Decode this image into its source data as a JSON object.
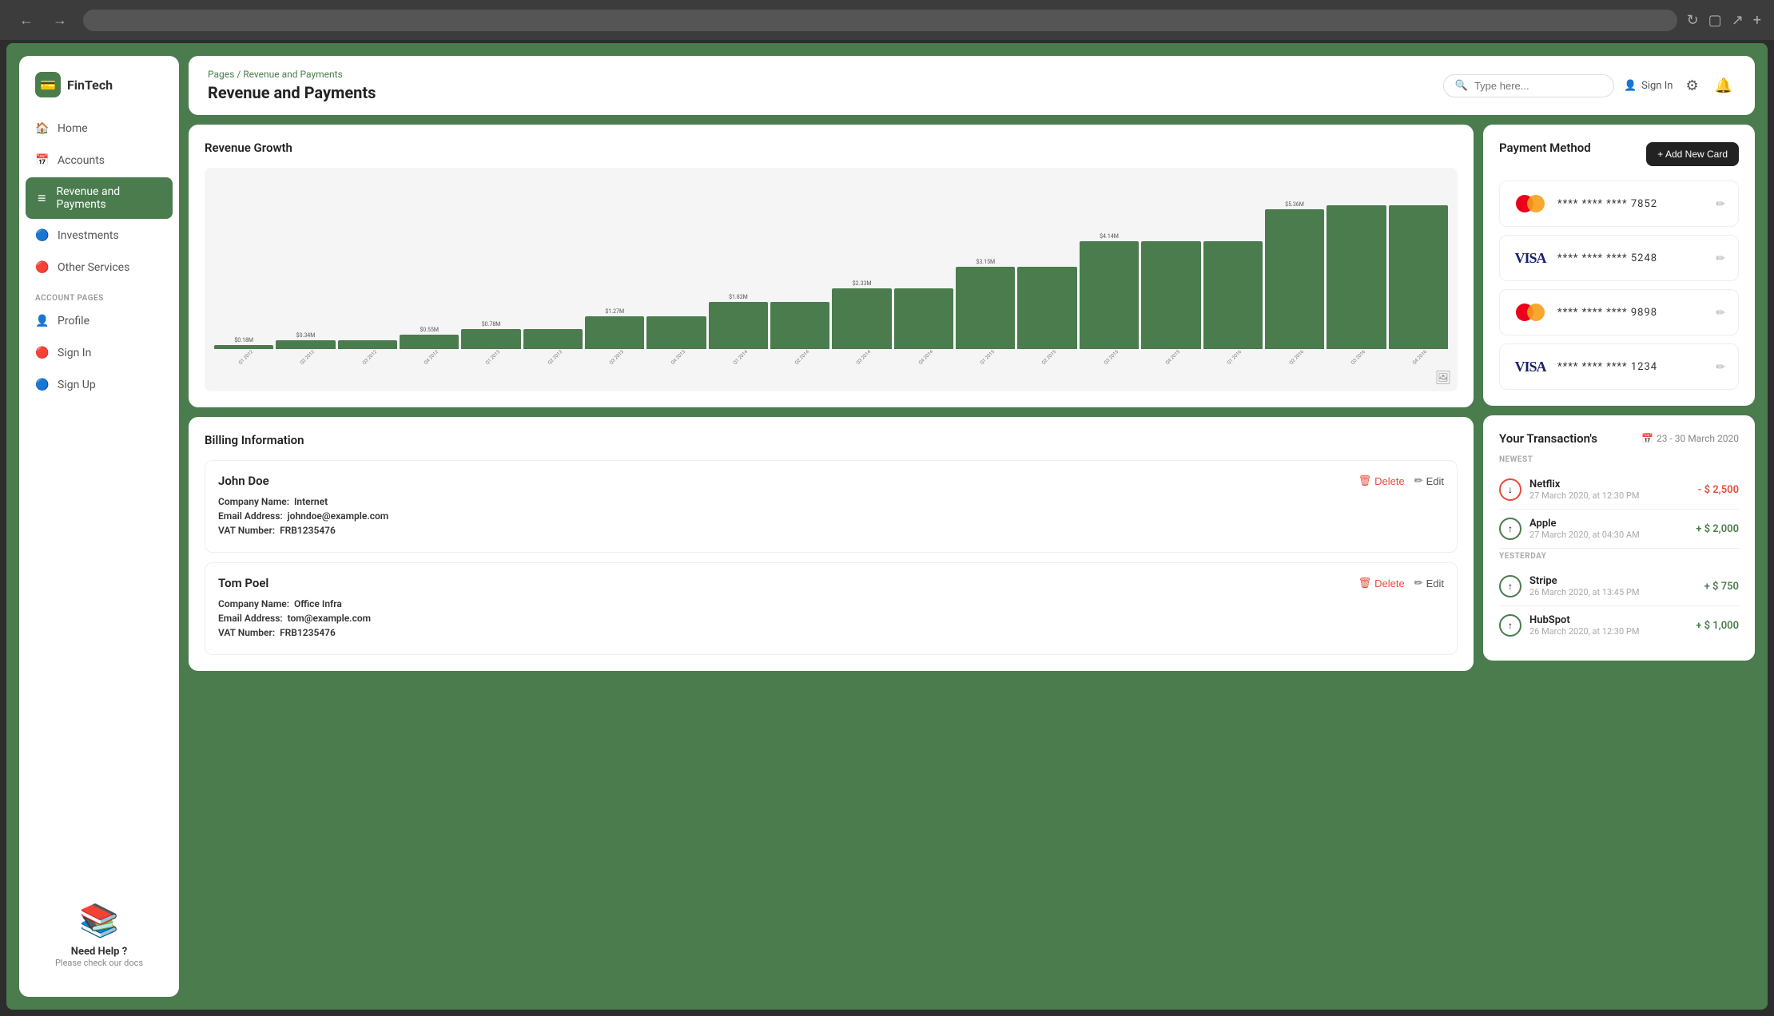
{
  "browser": {
    "url": ""
  },
  "sidebar": {
    "logo": "FinTech",
    "logo_icon": "🏦",
    "nav_items": [
      {
        "label": "Home",
        "icon": "🏠",
        "active": false,
        "id": "home"
      },
      {
        "label": "Accounts",
        "icon": "📅",
        "active": false,
        "id": "accounts"
      },
      {
        "label": "Revenue and Payments",
        "icon": "≡",
        "active": true,
        "id": "revenue"
      },
      {
        "label": "Investments",
        "icon": "🔵",
        "active": false,
        "id": "investments"
      },
      {
        "label": "Other Services",
        "icon": "🔴",
        "active": false,
        "id": "other-services"
      }
    ],
    "account_section_title": "ACCOUNT PAGES",
    "account_items": [
      {
        "label": "Profile",
        "icon": "👤",
        "id": "profile"
      },
      {
        "label": "Sign In",
        "icon": "🔴",
        "id": "sign-in"
      },
      {
        "label": "Sign Up",
        "icon": "🔵",
        "id": "sign-up"
      }
    ],
    "help": {
      "title": "Need Help ?",
      "subtitle": "Please check our docs"
    }
  },
  "header": {
    "breadcrumb_pages": "Pages",
    "breadcrumb_separator": "/",
    "breadcrumb_current": "Revenue and Payments",
    "page_title": "Revenue and Payments",
    "search_placeholder": "Type here...",
    "sign_in_label": "Sign In"
  },
  "revenue_growth": {
    "title": "Revenue Growth",
    "bars": [
      {
        "label": "Q1 2012",
        "value": 0.18,
        "display": "$0.18M",
        "height_pct": 3
      },
      {
        "label": "Q2 2012",
        "value": 0.34,
        "display": "$0.34M",
        "height_pct": 6
      },
      {
        "label": "Q3 2012",
        "value": 0.34,
        "display": "",
        "height_pct": 6
      },
      {
        "label": "Q4 2012",
        "value": 0.55,
        "display": "$0.55M",
        "height_pct": 10
      },
      {
        "label": "Q1 2013",
        "value": 0.78,
        "display": "$0.78M",
        "height_pct": 14
      },
      {
        "label": "Q2 2013",
        "value": 0.78,
        "display": "",
        "height_pct": 14
      },
      {
        "label": "Q3 2013",
        "value": 1.27,
        "display": "$1.27M",
        "height_pct": 23
      },
      {
        "label": "Q4 2013",
        "value": 1.27,
        "display": "",
        "height_pct": 23
      },
      {
        "label": "Q1 2014",
        "value": 1.82,
        "display": "$1.82M",
        "height_pct": 33
      },
      {
        "label": "Q2 2014",
        "value": 1.82,
        "display": "",
        "height_pct": 33
      },
      {
        "label": "Q3 2014",
        "value": 2.33,
        "display": "$2.33M",
        "height_pct": 42
      },
      {
        "label": "Q4 2014",
        "value": 2.33,
        "display": "",
        "height_pct": 42
      },
      {
        "label": "Q1 2015",
        "value": 3.15,
        "display": "$3.15M",
        "height_pct": 57
      },
      {
        "label": "Q2 2015",
        "value": 3.15,
        "display": "",
        "height_pct": 57
      },
      {
        "label": "Q3 2015",
        "value": 4.14,
        "display": "$4.14M",
        "height_pct": 75
      },
      {
        "label": "Q4 2015",
        "value": 4.14,
        "display": "",
        "height_pct": 75
      },
      {
        "label": "Q1 2016",
        "value": 4.14,
        "display": "",
        "height_pct": 75
      },
      {
        "label": "Q2 2016",
        "value": 5.36,
        "display": "$5.36M",
        "height_pct": 97
      },
      {
        "label": "Q3 2016",
        "value": 5.36,
        "display": "",
        "height_pct": 100
      },
      {
        "label": "Q4 2016",
        "value": 5.36,
        "display": "",
        "height_pct": 100
      }
    ]
  },
  "payment_method": {
    "title": "Payment Method",
    "add_card_label": "+ Add New Card",
    "cards": [
      {
        "type": "mastercard",
        "masked": "**** **** **** 7852",
        "last4": "7852"
      },
      {
        "type": "visa",
        "masked": "**** **** **** 5248",
        "last4": "5248"
      },
      {
        "type": "mastercard",
        "masked": "**** **** **** 9898",
        "last4": "9898"
      },
      {
        "type": "visa",
        "masked": "**** **** **** 1234",
        "last4": "1234"
      }
    ]
  },
  "billing": {
    "title": "Billing Information",
    "delete_label": "Delete",
    "edit_label": "Edit",
    "entries": [
      {
        "name": "John Doe",
        "company_label": "Company Name:",
        "company": "Internet",
        "email_label": "Email Address:",
        "email": "johndoe@example.com",
        "vat_label": "VAT Number:",
        "vat": "FRB1235476"
      },
      {
        "name": "Tom Poel",
        "company_label": "Company Name:",
        "company": "Office Infra",
        "email_label": "Email Address:",
        "email": "tom@example.com",
        "vat_label": "VAT Number:",
        "vat": "FRB1235476"
      }
    ]
  },
  "transactions": {
    "title": "Your Transaction's",
    "date_range": "23 - 30 March 2020",
    "sections": [
      {
        "label": "NEWEST",
        "items": [
          {
            "name": "Netflix",
            "date": "27 March 2020, at 12:30 PM",
            "amount": "- $ 2,500",
            "type": "negative"
          },
          {
            "name": "Apple",
            "date": "27 March 2020, at 04:30 AM",
            "amount": "+ $ 2,000",
            "type": "positive"
          }
        ]
      },
      {
        "label": "YESTERDAY",
        "items": [
          {
            "name": "Stripe",
            "date": "26 March 2020, at 13:45 PM",
            "amount": "+ $ 750",
            "type": "positive"
          },
          {
            "name": "HubSpot",
            "date": "26 March 2020, at 12:30 PM",
            "amount": "+ $ 1,000",
            "type": "positive"
          }
        ]
      }
    ]
  }
}
